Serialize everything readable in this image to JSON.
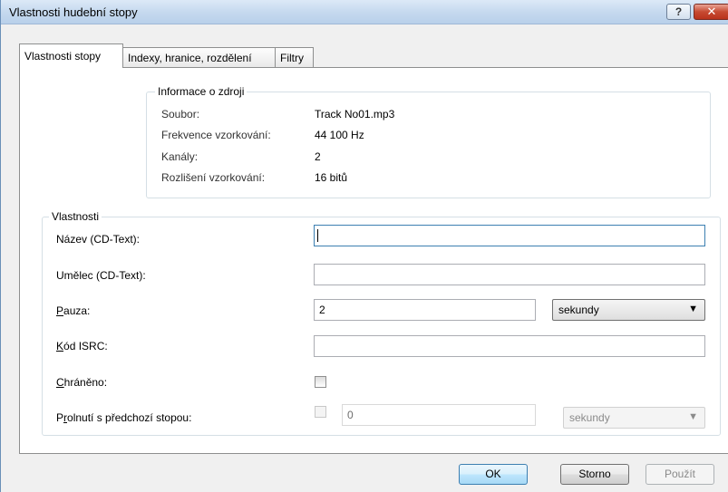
{
  "window": {
    "title": "Vlastnosti hudební stopy",
    "help_label": "?",
    "close_label": "✕"
  },
  "tabs": [
    {
      "label": "Vlastnosti stopy",
      "active": true
    },
    {
      "label": "Indexy, hranice, rozdělení",
      "active": false
    },
    {
      "label": "Filtry",
      "active": false
    }
  ],
  "source_info": {
    "title": "Informace o zdroji",
    "rows": [
      {
        "label": "Soubor:",
        "value": "Track No01.mp3"
      },
      {
        "label": "Frekvence vzorkování:",
        "value": "44 100 Hz"
      },
      {
        "label": "Kanály:",
        "value": "2"
      },
      {
        "label": "Rozlišení vzorkování:",
        "value": "16 bitů"
      }
    ]
  },
  "properties": {
    "title": "Vlastnosti",
    "name_label": "Název (CD-Text):",
    "name_value": "",
    "artist_label": "Umělec (CD-Text):",
    "artist_value": "",
    "pause_label_u": "P",
    "pause_label_rest": "auza:",
    "pause_value": "2",
    "pause_unit": "sekundy",
    "isrc_label_u": "K",
    "isrc_label_rest": "ód ISRC:",
    "isrc_value": "",
    "protected_label_u": "C",
    "protected_label_rest": "hráněno:",
    "protected_checked": false,
    "crossfade_label_pre": "P",
    "crossfade_label_u": "r",
    "crossfade_label_rest": "olnutí s předchozí stopou:",
    "crossfade_checked": false,
    "crossfade_value": "0",
    "crossfade_unit": "sekundy",
    "dropdown_arrow": "▼"
  },
  "buttons": {
    "ok": "OK",
    "cancel": "Storno",
    "apply": "Použít"
  }
}
